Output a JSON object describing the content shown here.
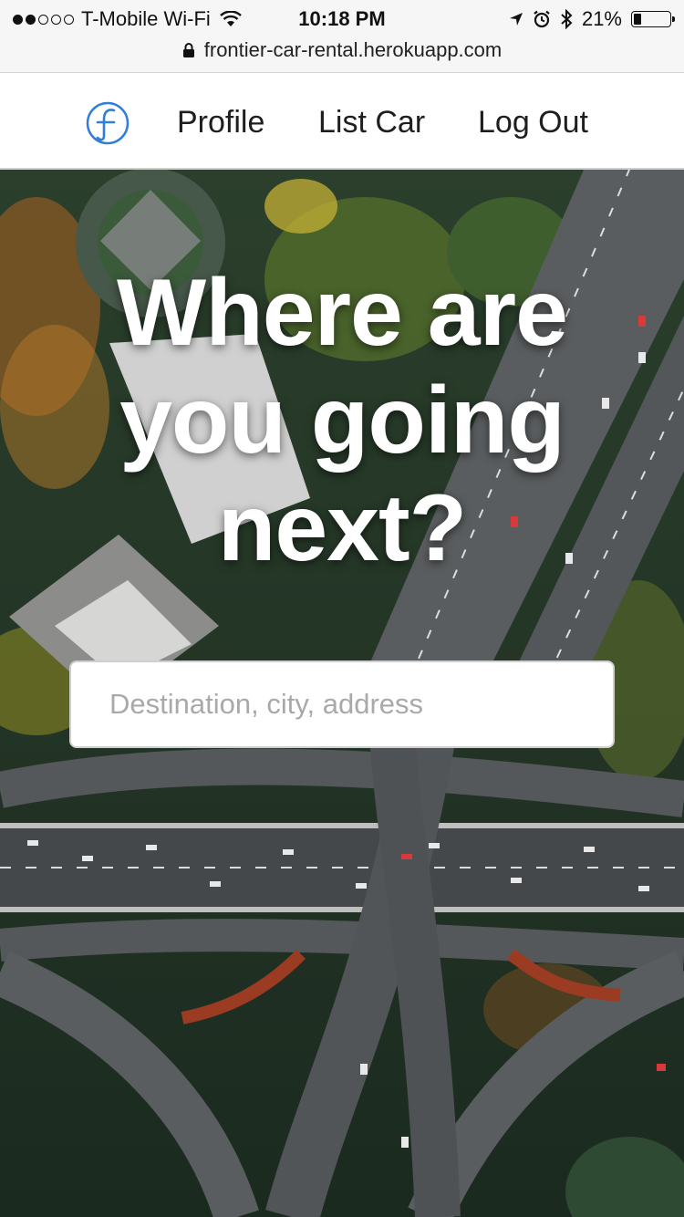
{
  "status_bar": {
    "carrier": "T-Mobile Wi-Fi",
    "time": "10:18 PM",
    "battery": "21%",
    "battery_level": 0.21,
    "signal_bars_filled": 2,
    "signal_bars_total": 5,
    "icons": [
      "wifi-icon",
      "location-arrow-icon",
      "alarm-icon",
      "bluetooth-icon",
      "battery-icon"
    ]
  },
  "address_bar": {
    "url": "frontier-car-rental.herokuapp.com",
    "icon": "lock-icon"
  },
  "nav": {
    "logo_icon": "frontier-logo-icon",
    "logo_color": "#2f7fd8",
    "links": [
      {
        "label": "Profile"
      },
      {
        "label": "List Car"
      },
      {
        "label": "Log Out"
      }
    ]
  },
  "hero": {
    "headline_lines": [
      "Where are",
      "you going",
      "next?"
    ],
    "search": {
      "placeholder": "Destination, city, address",
      "value": ""
    }
  }
}
